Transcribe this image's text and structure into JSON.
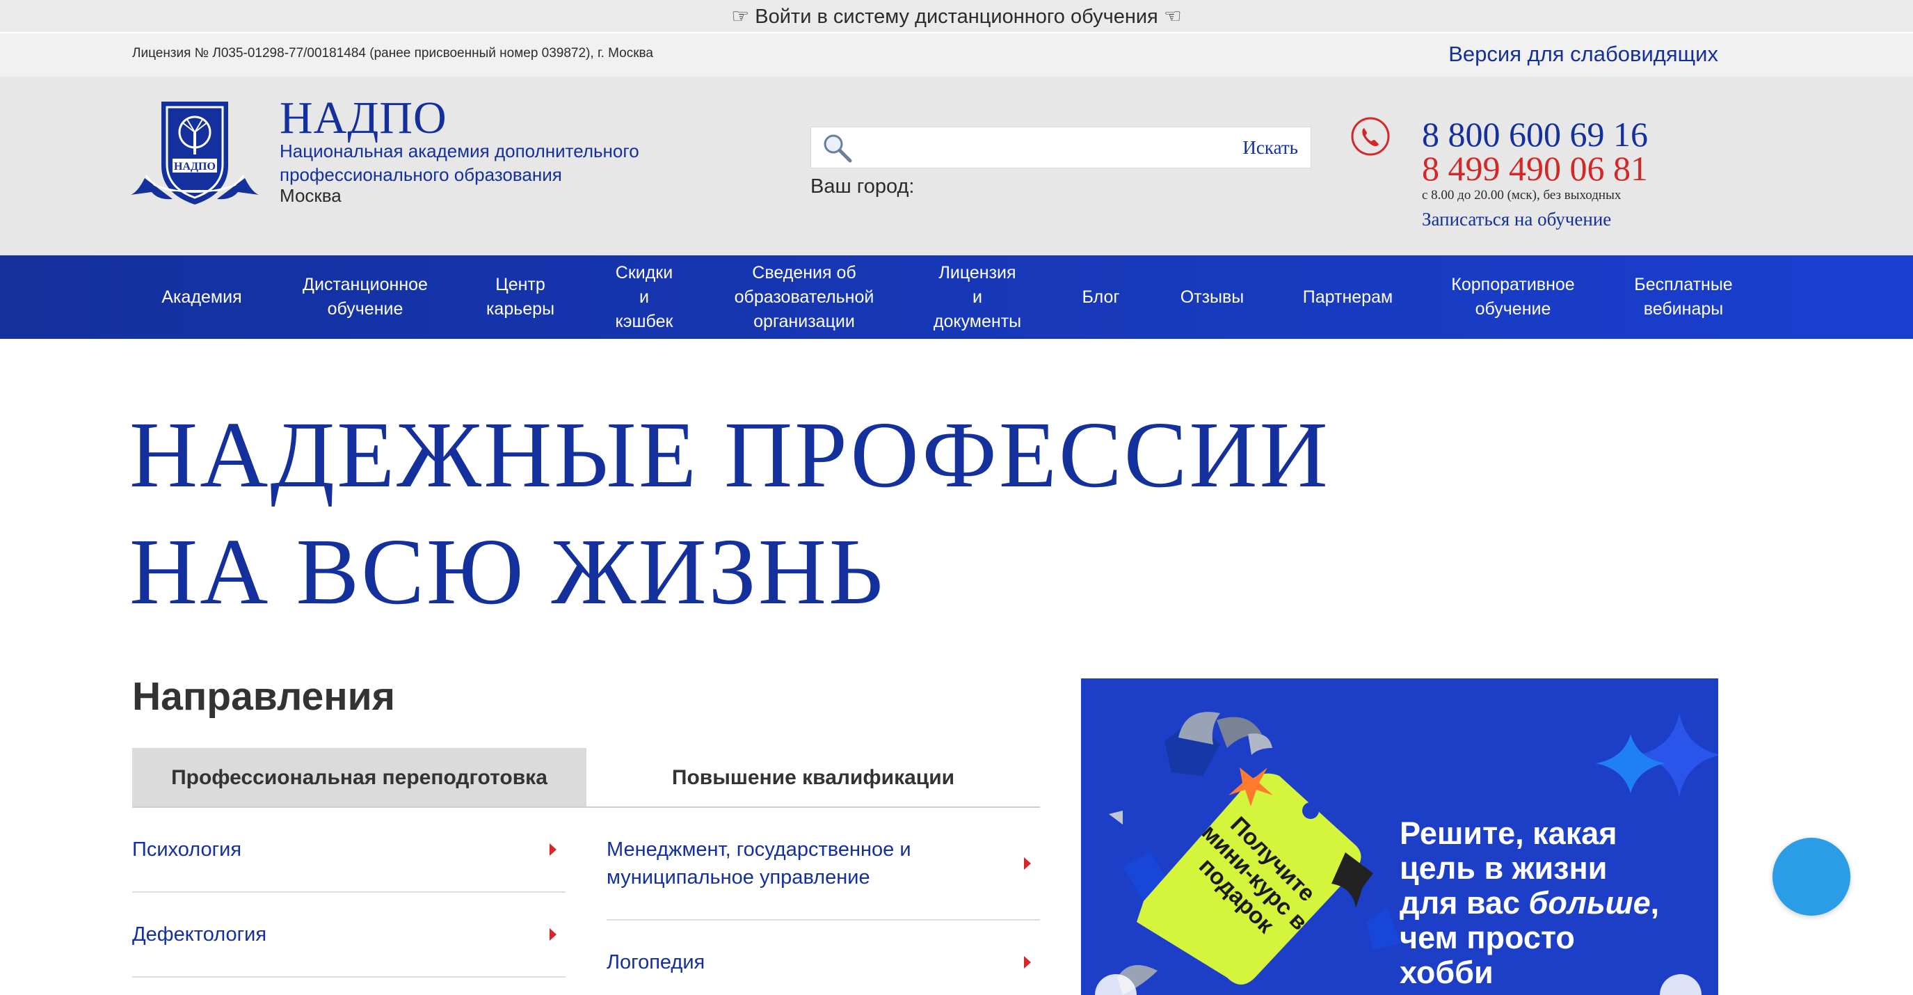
{
  "topbar": {
    "login_text": "☞ Войти в систему дистанционного обучения ☜"
  },
  "license_bar": {
    "license": "Лицензия № Л035-01298-77/00181484 (ранее присвоенный номер 039872), г. Москва",
    "vision_link": "Версия для слабовидящих"
  },
  "header": {
    "logo_text": "НАДПО",
    "title": "НАДПО",
    "subtitle": "Национальная академия дополнительного профессионального образования",
    "city": "Москва",
    "search": {
      "button": "Искать",
      "placeholder": ""
    },
    "city_label": "Ваш город:",
    "phone_primary": "8 800 600 69 16",
    "phone_secondary": "8 499 490 06 81",
    "hours": "с 8.00 до 20.00 (мск), без выходных",
    "enroll_link": "Записаться на обучение"
  },
  "nav": {
    "items": [
      {
        "label": "Академия"
      },
      {
        "label": "Дистанционное\nобучение"
      },
      {
        "label": "Центр\nкарьеры"
      },
      {
        "label": "Скидки\nи\nкэшбек"
      },
      {
        "label": "Сведения об\nобразовательной\nорганизации"
      },
      {
        "label": "Лицензия\nи\nдокументы"
      },
      {
        "label": "Блог"
      },
      {
        "label": "Отзывы"
      },
      {
        "label": "Партнерам"
      },
      {
        "label": "Корпоративное\nобучение"
      },
      {
        "label": "Бесплатные\nвебинары"
      }
    ]
  },
  "hero": {
    "line1": "НАДЕЖНЫЕ ПРОФЕССИИ",
    "line2": "НА ВСЮ ЖИЗНЬ"
  },
  "directions": {
    "title": "Направления",
    "tabs": [
      {
        "label": "Профессиональная переподготовка",
        "active": true
      },
      {
        "label": "Повышение квалификации",
        "active": false
      }
    ],
    "left_items": [
      {
        "label": "Психология"
      },
      {
        "label": "Дефектология"
      }
    ],
    "right_items": [
      {
        "label": "Менеджмент, государственное и муниципальное управление"
      },
      {
        "label": "Логопедия"
      }
    ]
  },
  "banner": {
    "tag_text": "Получите мини-курс в подарок",
    "headline_1": "Решите, какая",
    "headline_2": "цель в жизни",
    "headline_3a": "для вас ",
    "headline_3b": "больше",
    "headline_3c": ",",
    "headline_4": "чем просто",
    "headline_5": "хобби"
  },
  "colors": {
    "brand_blue": "#13309c",
    "accent_red": "#d42828",
    "nav_blue": "#1a3fd0",
    "banner_blue": "#1d3fc7",
    "tag_lime": "#d4f53c",
    "chat_blue": "#2a9de6"
  },
  "icons": {
    "search": "magnifier-icon",
    "phone": "phone-icon",
    "chat": "chat-icon",
    "arrow": "triangle-right-icon"
  }
}
